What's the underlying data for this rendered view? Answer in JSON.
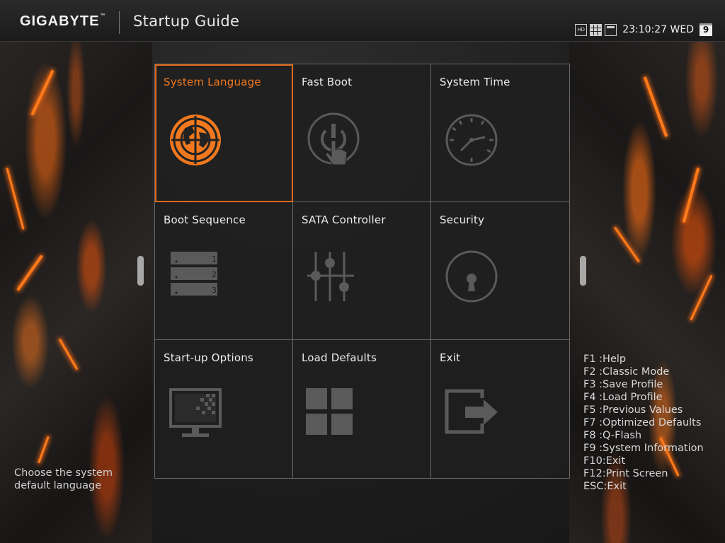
{
  "header": {
    "brand": "GIGABYTE",
    "trademark": "™",
    "title": "Startup Guide",
    "status_icons": [
      "hd-mode-icon",
      "grid-view-icon",
      "window-view-icon"
    ],
    "hd_label": "HD",
    "clock": "23:10:27 WED",
    "calendar_day": "9"
  },
  "tiles": [
    {
      "label": "System Language",
      "icon": "globe-icon",
      "selected": true
    },
    {
      "label": "Fast Boot",
      "icon": "power-touch-icon",
      "selected": false
    },
    {
      "label": "System Time",
      "icon": "clock-icon",
      "selected": false
    },
    {
      "label": "Boot Sequence",
      "icon": "boot-list-icon",
      "selected": false
    },
    {
      "label": "SATA Controller",
      "icon": "sliders-icon",
      "selected": false
    },
    {
      "label": "Security",
      "icon": "lock-icon",
      "selected": false
    },
    {
      "label": "Start-up Options",
      "icon": "monitor-icon",
      "selected": false
    },
    {
      "label": "Load Defaults",
      "icon": "defaults-grid-icon",
      "selected": false
    },
    {
      "label": "Exit",
      "icon": "exit-icon",
      "selected": false
    }
  ],
  "boot_sequence_numbers": [
    "1",
    "2",
    "3"
  ],
  "description": "Choose the system default language",
  "hotkeys": [
    "F1 :Help",
    "F2 :Classic Mode",
    "F3 :Save Profile",
    "F4 :Load Profile",
    "F5 :Previous Values",
    "F7 :Optimized Defaults",
    "F8 :Q-Flash",
    "F9 :System Information",
    "F10:Exit",
    "F12:Print Screen",
    "ESC:Exit"
  ],
  "colors": {
    "accent": "#f0781f",
    "icon_gray": "#5a5a5a",
    "grid_line": "#6a6a6a"
  }
}
